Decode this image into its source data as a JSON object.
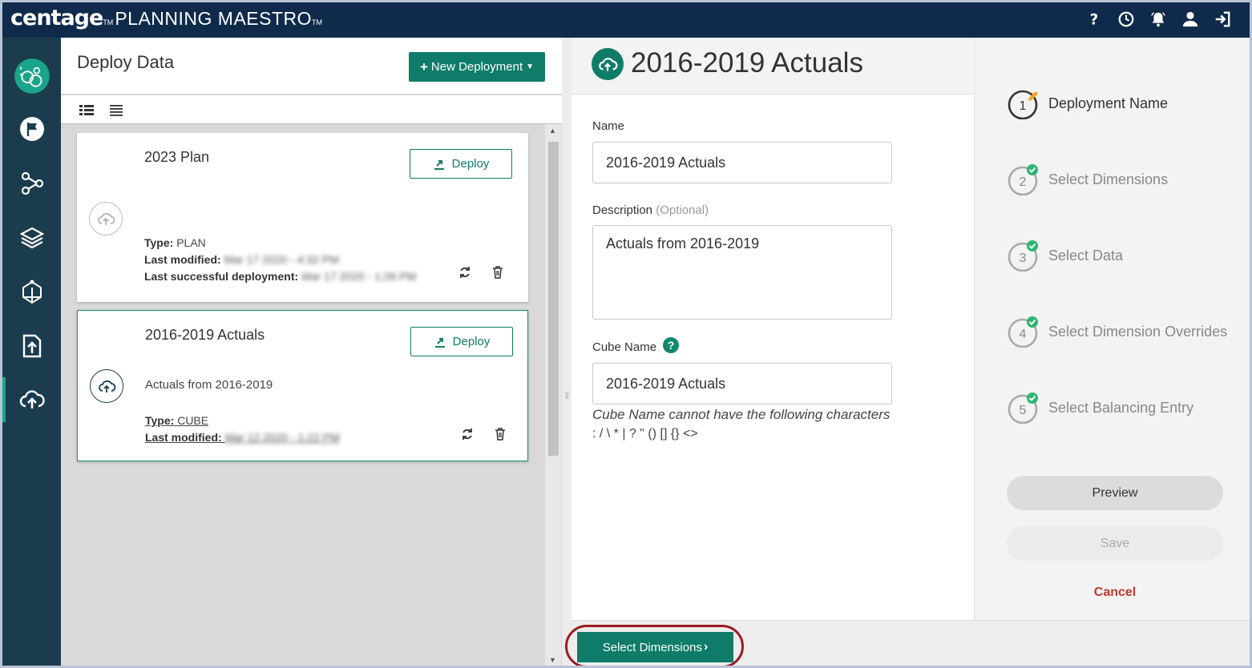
{
  "app": {
    "brand": "centage",
    "tm": "TM",
    "product": "PLANNING MAESTRO",
    "product_tm": "TM",
    "top_icons": [
      "help-icon",
      "history-icon",
      "notifications-icon",
      "user-icon",
      "logout-icon"
    ]
  },
  "nav": {
    "items": [
      "home-icon",
      "flag-icon",
      "flow-icon",
      "layers-icon",
      "model-icon",
      "upload-icon",
      "deploy-icon"
    ],
    "active": "deploy-icon"
  },
  "left_panel": {
    "title": "Deploy Data",
    "new_button": "New Deployment",
    "cards": [
      {
        "title": "2023 Plan",
        "deploy_label": "Deploy",
        "description": "",
        "type_label": "Type:",
        "type_value": "PLAN",
        "modified_label": "Last modified:",
        "modified_value": "Mar 17 2020 - 4:32 PM",
        "success_label": "Last successful deployment:",
        "success_value": "Mar 17 2020 - 1:26 PM"
      },
      {
        "title": "2016-2019 Actuals",
        "deploy_label": "Deploy",
        "description": "Actuals from 2016-2019",
        "type_label": "Type:",
        "type_value": "CUBE",
        "modified_label": "Last modified:",
        "modified_value": "Mar 12 2020 - 1:22 PM"
      }
    ]
  },
  "form": {
    "title": "2016-2019 Actuals",
    "name_label": "Name",
    "name_value": "2016-2019 Actuals",
    "desc_label": "Description",
    "desc_optional": "(Optional)",
    "desc_value": "Actuals from 2016-2019",
    "cube_label": "Cube Name",
    "cube_help": "?",
    "cube_value": "2016-2019 Actuals",
    "cube_hint": "Cube Name cannot have the following characters",
    "cube_chars": ": / \\ * | ? \" () [] {} <>"
  },
  "steps": {
    "items": [
      {
        "number": "1",
        "label": "Deployment Name",
        "status": "editing"
      },
      {
        "number": "2",
        "label": "Select Dimensions",
        "status": "complete"
      },
      {
        "number": "3",
        "label": "Select Data",
        "status": "complete"
      },
      {
        "number": "4",
        "label": "Select Dimension Overrides",
        "status": "complete"
      },
      {
        "number": "5",
        "label": "Select Balancing Entry",
        "status": "complete"
      }
    ],
    "preview": "Preview",
    "save": "Save",
    "cancel": "Cancel"
  },
  "footer": {
    "next_button": "Select Dimensions"
  },
  "colors": {
    "topbar": "#0f2a4b",
    "nav": "#1b3c4e",
    "accent": "#0e7c68",
    "highlight": "#9b1c20",
    "cancel": "#c0392b"
  }
}
